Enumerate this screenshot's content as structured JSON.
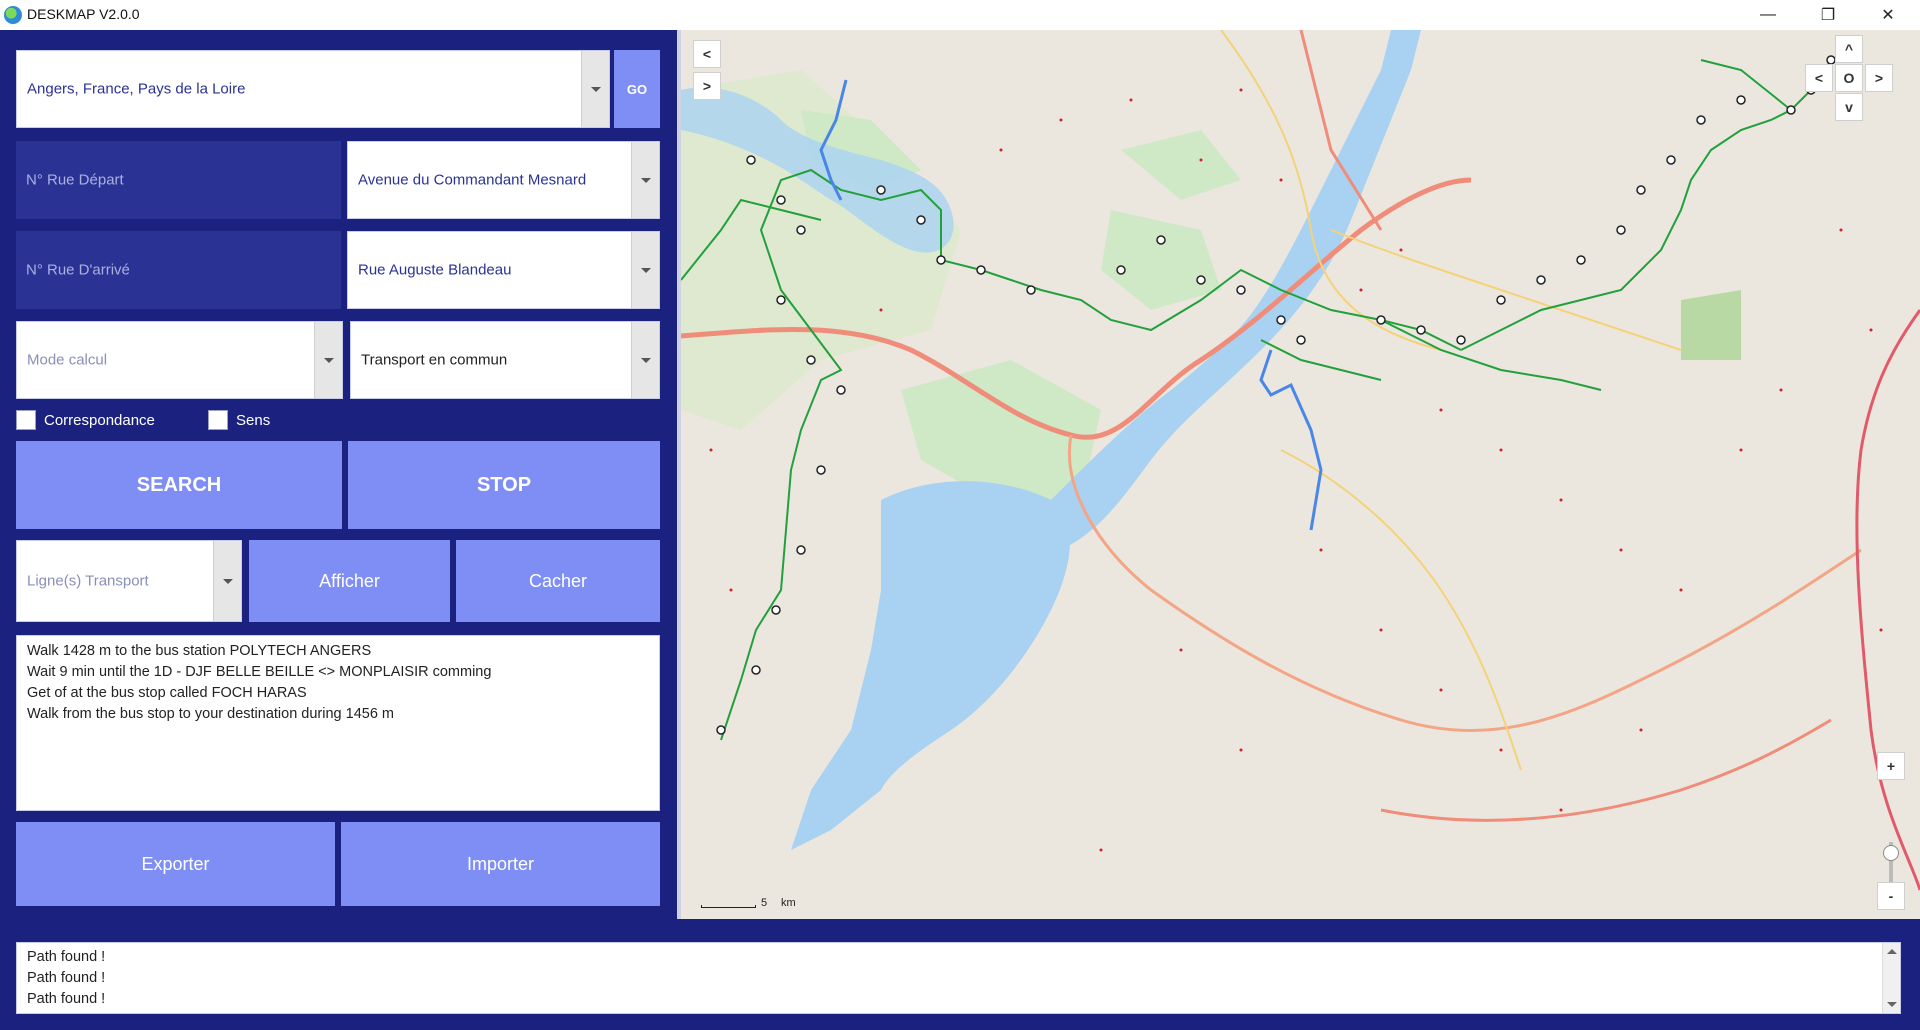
{
  "window": {
    "title": "DESKMAP V2.0.0",
    "minimize": "—",
    "maximize": "❐",
    "close": "✕"
  },
  "search": {
    "location_value": "Angers, France, Pays de la Loire",
    "go_label": "GO"
  },
  "route": {
    "start_number_placeholder": "N° Rue Départ",
    "start_street": "Avenue du Commandant Mesnard",
    "end_number_placeholder": "N° Rue D'arrivé",
    "end_street": "Rue Auguste Blandeau",
    "mode_placeholder": "Mode calcul",
    "mode_value": "Transport en commun"
  },
  "options": {
    "correspondance_label": "Correspondance",
    "sens_label": "Sens"
  },
  "actions": {
    "search_label": "SEARCH",
    "stop_label": "STOP",
    "lines_placeholder": "Ligne(s) Transport",
    "show_label": "Afficher",
    "hide_label": "Cacher",
    "export_label": "Exporter",
    "import_label": "Importer"
  },
  "directions": [
    "Walk 1428 m to the bus station POLYTECH ANGERS",
    "Wait 9 min until the 1D - DJF  BELLE BEILLE <> MONPLAISIR comming",
    "Get of at the bus stop called FOCH HARAS",
    "Walk from the bus stop to your destination during 1456 m"
  ],
  "map": {
    "pan_left": "<",
    "pan_right": ">",
    "nav_up": "^",
    "nav_left": "<",
    "nav_center": "O",
    "nav_right": ">",
    "nav_down": "v",
    "zoom_in": "+",
    "zoom_out": "-",
    "scale_value": "5",
    "scale_unit": "km",
    "colors": {
      "river": "#a9d2f2",
      "route_walk": "#4a86e8",
      "transit_line": "#22a03c",
      "main_road": "#f08d7a"
    }
  },
  "log": [
    "Path found !",
    "Path found !",
    "Path found !"
  ]
}
